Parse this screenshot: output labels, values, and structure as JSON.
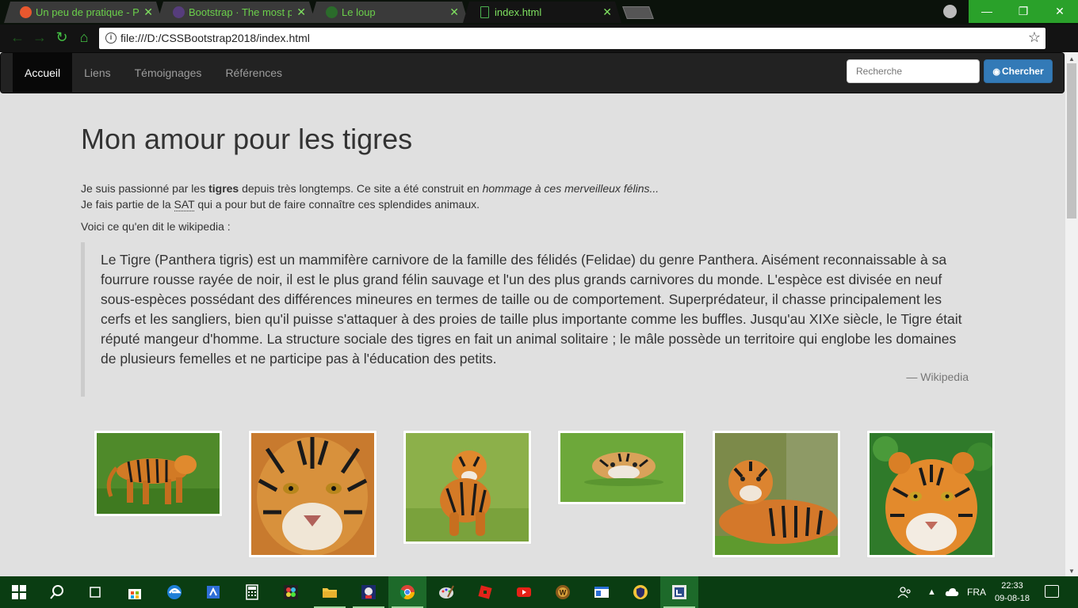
{
  "browser": {
    "tabs": [
      {
        "title": "Un peu de pratique - Pre",
        "favicon_color": "#e8572e"
      },
      {
        "title": "Bootstrap · The most pop",
        "favicon_color": "#563d7c"
      },
      {
        "title": "Le loup",
        "favicon_color": "#2b6b2b"
      },
      {
        "title": "index.html",
        "favicon_color": "#4caf50"
      }
    ],
    "close_glyph": "✕",
    "url": "file:///D:/CSSBootstrap2018/index.html"
  },
  "navbar": {
    "links": [
      "Accueil",
      "Liens",
      "Témoignages",
      "Références"
    ],
    "search_placeholder": "Recherche",
    "search_button": "Chercher"
  },
  "page": {
    "title": "Mon amour pour les tigres",
    "intro1_a": "Je suis passionné par les ",
    "intro1_b": "tigres",
    "intro1_c": " depuis très longtemps. Ce site a été construit en ",
    "intro1_d": "hommage à ces merveilleux félins...",
    "intro2_a": "Je fais partie de la ",
    "intro2_abbr": "SAT",
    "intro2_b": " qui a pour but de faire connaître ces splendides animaux.",
    "wiki_intro": "Voici ce qu'en dit le wikipedia :",
    "quote": "Le Tigre (Panthera tigris) est un mammifère carnivore de la famille des félidés (Felidae) du genre Panthera. Aisément reconnaissable à sa fourrure rousse rayée de noir, il est le plus grand félin sauvage et l'un des plus grands carnivores du monde. L'espèce est divisée en neuf sous-espèces possédant des différences mineures en termes de taille ou de comportement. Superprédateur, il chasse principalement les cerfs et les sangliers, bien qu'il puisse s'attaquer à des proies de taille plus importante comme les buffles. Jusqu'au XIXe siècle, le Tigre était réputé mangeur d'homme. La structure sociale des tigres en fait un animal solitaire ; le mâle possède un territoire qui englobe les domaines de plusieurs femelles et ne participe pas à l'éducation des petits.",
    "quote_source": "— Wikipedia"
  },
  "taskbar": {
    "language": "FRA",
    "time": "22:33",
    "date": "09-08-18"
  },
  "colors": {
    "navbar_bg": "#222222",
    "primary_button": "#337ab7",
    "page_bg": "#e0e0e0",
    "browser_accent": "#2aa12a"
  }
}
